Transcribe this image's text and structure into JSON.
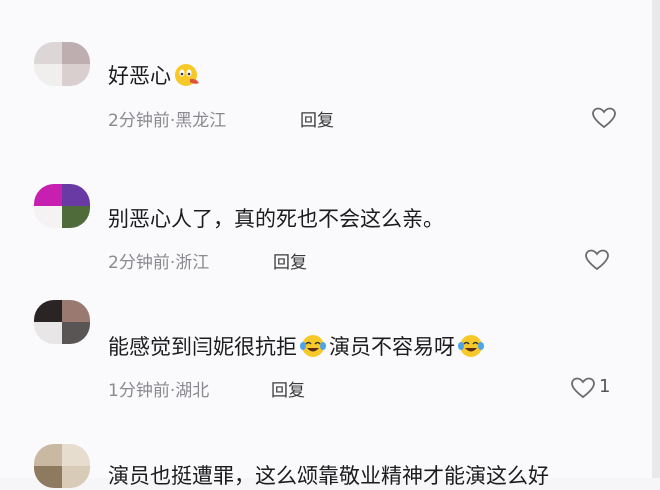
{
  "comments": [
    {
      "text": "好恶心",
      "time": "2分钟前",
      "location": "黑龙江",
      "reply_label": "回复"
    },
    {
      "text": "别恶心人了，真的死也不会这么亲。",
      "time": "2分钟前",
      "location": "浙江",
      "reply_label": "回复"
    },
    {
      "text_part1": "能感觉到闫妮很抗拒",
      "text_part2": "演员不容易呀",
      "time": "1分钟前",
      "location": "湖北",
      "reply_label": "回复",
      "like_count": "1"
    },
    {
      "text": "演员也挺遭罪，这么颂靠敬业精神才能演这么好"
    }
  ],
  "meta_separator": "·",
  "colors": {
    "text": "#1c1c1e",
    "meta": "#8a8a8f",
    "background": "#fafafc"
  },
  "icons": [
    "heart-icon",
    "drooling-emoji",
    "laughing-tears-emoji"
  ]
}
